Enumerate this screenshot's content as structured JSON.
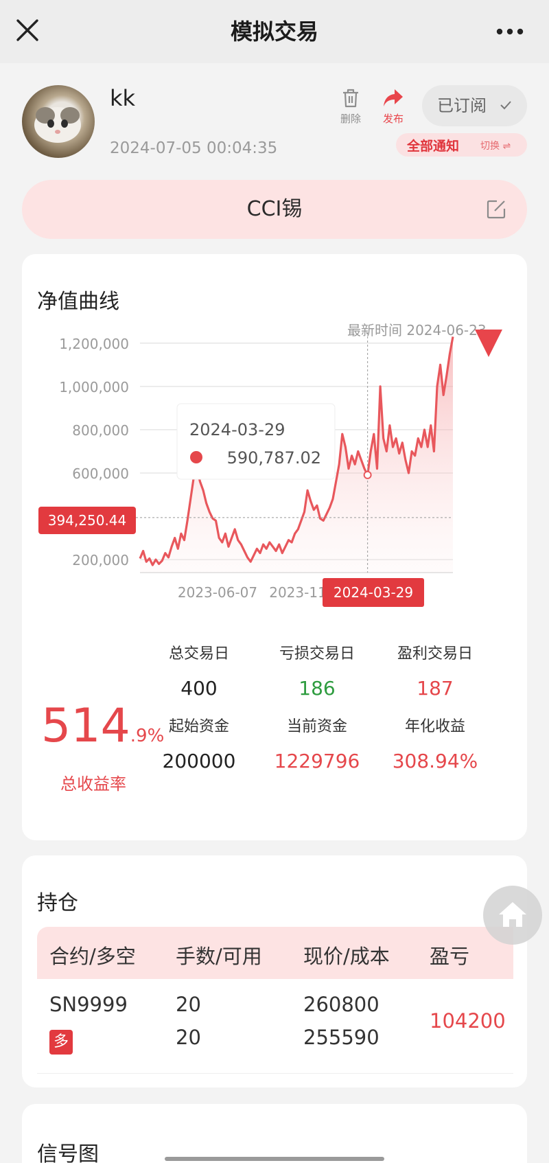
{
  "navbar": {
    "title": "模拟交易"
  },
  "profile": {
    "username": "kk",
    "post_time": "2024-07-05 00:04:35",
    "delete_label": "删除",
    "publish_label": "发布",
    "subscribed_label": "已订阅",
    "notify_label": "全部通知",
    "switch_label": "切换 ⇌"
  },
  "strategy": {
    "name": "CCI锡"
  },
  "equity": {
    "title": "净值曲线",
    "latest_time_label": "最新时间 2024-06-23",
    "tooltip_date": "2024-03-29",
    "tooltip_value": "590,787.02",
    "crosshair_value_label": "394,250.44",
    "crosshair_date_label": "2024-03-29"
  },
  "chart_data": {
    "type": "area",
    "title": "",
    "xlabel": "",
    "ylabel": "",
    "ylim": [
      140000,
      1250000
    ],
    "y_ticks": [
      200000,
      600000,
      800000,
      1000000,
      1200000
    ],
    "y_tick_labels": [
      "200,000",
      "600,000",
      "800,000",
      "1,000,000",
      "1,200,000"
    ],
    "x_tick_labels": [
      "2023-06-07",
      "2023-11-0"
    ],
    "grid": true,
    "color": "#e8575c",
    "series": [
      {
        "values": [
          205000,
          240000,
          190000,
          205000,
          175000,
          200000,
          180000,
          195000,
          230000,
          210000,
          260000,
          300000,
          250000,
          320000,
          290000,
          380000,
          480000,
          580000,
          620000,
          560000,
          520000,
          460000,
          420000,
          390000,
          380000,
          300000,
          280000,
          320000,
          260000,
          300000,
          340000,
          290000,
          270000,
          240000,
          210000,
          190000,
          220000,
          250000,
          230000,
          270000,
          250000,
          280000,
          260000,
          240000,
          270000,
          230000,
          260000,
          290000,
          280000,
          320000,
          340000,
          380000,
          420000,
          520000,
          470000,
          430000,
          450000,
          390000,
          380000,
          410000,
          440000,
          480000,
          560000,
          640000,
          780000,
          720000,
          620000,
          680000,
          640000,
          700000,
          660000,
          620000,
          590787,
          700000,
          780000,
          620000,
          1000000,
          760000,
          700000,
          820000,
          720000,
          760000,
          690000,
          740000,
          660000,
          600000,
          700000,
          680000,
          760000,
          720000,
          800000,
          720000,
          820000,
          700000,
          1000000,
          1100000,
          960000,
          1050000,
          1150000,
          1229796
        ],
        "x_labels_for_markers": [
          "2024-03-29"
        ]
      }
    ],
    "highlight_index": 72,
    "crosshair_value": 394250.44
  },
  "stats": {
    "total_return_int": "514",
    "total_return_frac": ".9%",
    "total_return_label": "总收益率",
    "items": [
      {
        "key": "总交易日",
        "value": "400",
        "color": "#222222"
      },
      {
        "key": "亏损交易日",
        "value": "186",
        "color": "#2e9c3f"
      },
      {
        "key": "盈利交易日",
        "value": "187",
        "color": "#e5474b"
      },
      {
        "key": "起始资金",
        "value": "200000",
        "color": "#222222"
      },
      {
        "key": "当前资金",
        "value": "1229796",
        "color": "#e5474b"
      },
      {
        "key": "年化收益",
        "value": "308.94%",
        "color": "#e5474b"
      }
    ]
  },
  "positions": {
    "title": "持仓",
    "headers": [
      "合约/多空",
      "手数/可用",
      "现价/成本",
      "盈亏"
    ],
    "rows": [
      {
        "contract": "SN9999",
        "direction": "多",
        "lots": "20",
        "available": "20",
        "price": "260800",
        "cost": "255590",
        "pnl": "104200"
      }
    ]
  },
  "signal": {
    "title": "信号图"
  },
  "icons": {
    "close": "close-icon",
    "more": "more-icon",
    "delete": "trash-icon",
    "publish": "share-arrow-icon",
    "check": "check-icon",
    "edit": "edit-icon",
    "home": "home-icon"
  }
}
